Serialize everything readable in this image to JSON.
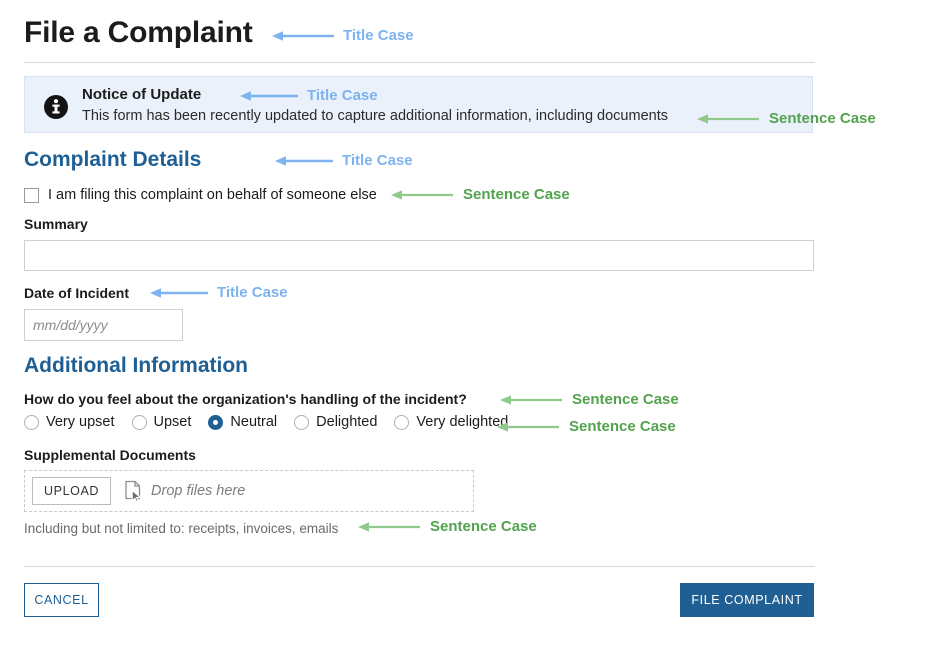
{
  "page": {
    "title": "File a Complaint"
  },
  "notice": {
    "icon": "info-circle-icon",
    "title": "Notice of Update",
    "body": "This form has been recently updated to capture additional information, including documents"
  },
  "sections": {
    "complaint_details": {
      "heading": "Complaint Details",
      "behalf_checkbox_label": "I am filing this complaint on behalf of someone else",
      "behalf_checkbox_checked": false,
      "summary_label": "Summary",
      "summary_value": "",
      "summary_placeholder": "",
      "date_label": "Date of Incident",
      "date_value": "",
      "date_placeholder": "mm/dd/yyyy"
    },
    "additional_information": {
      "heading": "Additional Information",
      "question_label": "How do you feel about the organization's handling of the incident?",
      "radio_options": [
        {
          "label": "Very upset",
          "selected": false
        },
        {
          "label": "Upset",
          "selected": false
        },
        {
          "label": "Neutral",
          "selected": true
        },
        {
          "label": "Delighted",
          "selected": false
        },
        {
          "label": "Very delighted",
          "selected": false
        }
      ],
      "documents_label": "Supplemental Documents",
      "upload_button_label": "UPLOAD",
      "drop_text": "Drop files here",
      "file_icon": "file-cursor-icon",
      "help_text": "Including but not limited to: receipts, invoices, emails"
    }
  },
  "footer": {
    "cancel_label": "CANCEL",
    "submit_label": "FILE COMPLAINT"
  },
  "annotations": [
    {
      "id": "a1",
      "text": "Title Case",
      "color": "blue",
      "target": "page-title"
    },
    {
      "id": "a2",
      "text": "Title Case",
      "color": "blue",
      "target": "notice-title"
    },
    {
      "id": "a3",
      "text": "Sentence Case",
      "color": "green",
      "target": "notice-body"
    },
    {
      "id": "a4",
      "text": "Title Case",
      "color": "blue",
      "target": "complaint-details-heading"
    },
    {
      "id": "a5",
      "text": "Sentence Case",
      "color": "green",
      "target": "behalf-checkbox-label"
    },
    {
      "id": "a6",
      "text": "Title Case",
      "color": "blue",
      "target": "date-of-incident-label"
    },
    {
      "id": "a7",
      "text": "Sentence Case",
      "color": "green",
      "target": "feeling-question-label"
    },
    {
      "id": "a8",
      "text": "Sentence Case",
      "color": "green",
      "target": "feeling-radio-group"
    },
    {
      "id": "a9",
      "text": "Sentence Case",
      "color": "green",
      "target": "documents-help-text"
    }
  ],
  "colors": {
    "heading_blue": "#1f5f94",
    "primary_button": "#205f93",
    "notice_background": "#eaf1fb",
    "annotation_blue": "#7eb3f0",
    "annotation_green": "#52a24e"
  }
}
